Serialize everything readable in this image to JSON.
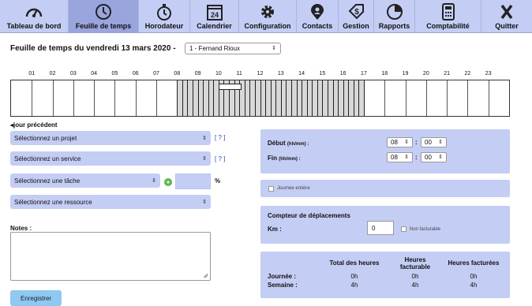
{
  "nav": {
    "items": [
      {
        "label": "Tableau de bord",
        "icon": "gauge-icon"
      },
      {
        "label": "Feuille de temps",
        "icon": "clock-icon"
      },
      {
        "label": "Horodateur",
        "icon": "stopwatch-icon"
      },
      {
        "label": "Calendrier",
        "icon": "calendar-icon"
      },
      {
        "label": "Configuration",
        "icon": "gear-icon"
      },
      {
        "label": "Contacts",
        "icon": "contact-pin-icon"
      },
      {
        "label": "Gestion",
        "icon": "dollar-tag-icon"
      },
      {
        "label": "Rapports",
        "icon": "pie-chart-icon"
      },
      {
        "label": "Comptabilité",
        "icon": "calculator-icon"
      },
      {
        "label": "Quitter",
        "icon": "close-x-icon"
      }
    ],
    "calendar_day": "24",
    "active_index": 1
  },
  "page": {
    "title": "Feuille de temps du vendredi 13 mars 2020 -",
    "employee": "1 - Fernand Rioux"
  },
  "timeline": {
    "hours": [
      "01",
      "02",
      "03",
      "04",
      "05",
      "06",
      "07",
      "08",
      "09",
      "10",
      "11",
      "12",
      "13",
      "14",
      "15",
      "16",
      "17",
      "18",
      "19",
      "20",
      "21",
      "22",
      "23"
    ],
    "work_start_hour": 8,
    "work_end_hour": 17,
    "current_slot": {
      "start": 10,
      "end": 11.1
    }
  },
  "form": {
    "prev_day": "jour précédent",
    "project_select": "Sélectionnez un projet",
    "service_select": "Sélectionnez un service",
    "task_select": "Sélectionnez une tâche",
    "resource_select": "Sélectionnez une ressource",
    "help": "[ ? ]",
    "percent": "%",
    "notes_label": "Notes :",
    "save": "Enregistrer"
  },
  "time": {
    "start_label": "Début",
    "end_label": "Fin",
    "unit": "(hh/mm) :",
    "start_hour": "08",
    "start_min": "00",
    "end_hour": "08",
    "end_min": "00",
    "full_day": "Journée entière"
  },
  "travel": {
    "title": "Compteur de déplacements",
    "km_label": "Km :",
    "km_value": "0",
    "non_billable": "Non facturable"
  },
  "summary": {
    "headers": [
      "Total des heures",
      "Heures facturable",
      "Heures facturées"
    ],
    "rows": [
      {
        "label": "Journée :",
        "values": [
          "0h",
          "0h",
          "0h"
        ]
      },
      {
        "label": "Semaine :",
        "values": [
          "4h",
          "4h",
          "4h"
        ]
      }
    ]
  }
}
